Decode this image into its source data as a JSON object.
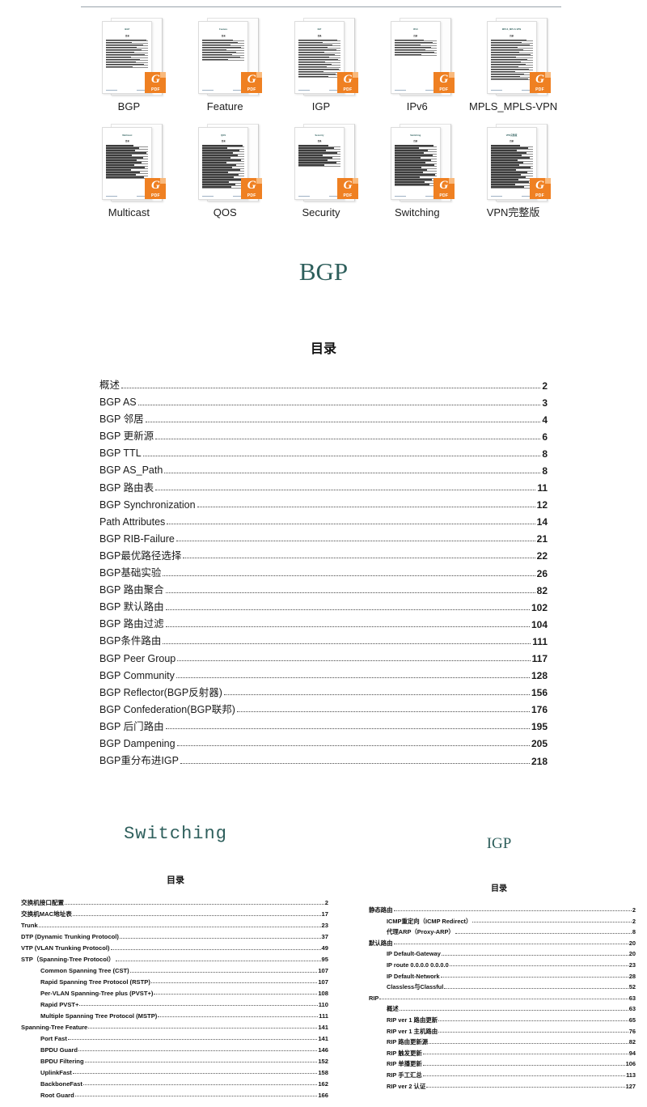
{
  "thumbnails": {
    "badge": {
      "glyph": "G",
      "label": "PDF",
      "color": "#ef8022"
    },
    "items": [
      {
        "label": "BGP",
        "mini_title": "BGP",
        "mini_sub": "目录",
        "lines": 12
      },
      {
        "label": "Feature",
        "mini_title": "Feature",
        "mini_sub": "目录",
        "lines": 9
      },
      {
        "label": "IGP",
        "mini_title": "IGP",
        "mini_sub": "目录",
        "lines": 16
      },
      {
        "label": "IPv6",
        "mini_title": "IPv6",
        "mini_sub": "目录",
        "lines": 7
      },
      {
        "label": "MPLS_MPLS-VPN",
        "mini_title": "MPLS_MPLS-VPN",
        "mini_sub": "目录",
        "lines": 17
      },
      {
        "label": "Multicast",
        "mini_title": "Multicast",
        "mini_sub": "目录",
        "lines": 14
      },
      {
        "label": "QOS",
        "mini_title": "QOS",
        "mini_sub": "目录",
        "lines": 18
      },
      {
        "label": "Security",
        "mini_title": "Security",
        "mini_sub": "目录",
        "lines": 9
      },
      {
        "label": "Switching",
        "mini_title": "Switching",
        "mini_sub": "目录",
        "lines": 17
      },
      {
        "label": "VPN完整版",
        "mini_title": "VPN完整版",
        "mini_sub": "目录",
        "lines": 18
      }
    ]
  },
  "bgp_doc": {
    "title": "BGP",
    "toc_heading": "目录",
    "title_color": "#2e5f5c",
    "entries": [
      {
        "title": "概述",
        "page": "2"
      },
      {
        "title": "BGP AS",
        "page": "3"
      },
      {
        "title": "BGP  邻居",
        "page": "4"
      },
      {
        "title": "BGP  更新源",
        "page": "6"
      },
      {
        "title": "BGP TTL",
        "page": "8"
      },
      {
        "title": "BGP AS_Path",
        "page": "8"
      },
      {
        "title": "BGP  路由表",
        "page": "11"
      },
      {
        "title": "BGP Synchronization",
        "page": "12"
      },
      {
        "title": "Path Attributes",
        "page": "14"
      },
      {
        "title": "BGP RIB-Failure",
        "page": "21"
      },
      {
        "title": "BGP最优路径选择",
        "page": "22"
      },
      {
        "title": "BGP基础实验",
        "page": "26"
      },
      {
        "title": "BGP  路由聚合",
        "page": "82"
      },
      {
        "title": "BGP  默认路由",
        "page": "102"
      },
      {
        "title": "BGP  路由过滤",
        "page": "104"
      },
      {
        "title": "BGP条件路由",
        "page": "111"
      },
      {
        "title": "BGP Peer Group",
        "page": "117"
      },
      {
        "title": "BGP Community",
        "page": "128"
      },
      {
        "title": "BGP Reflector(BGP反射器)",
        "page": "156"
      },
      {
        "title": "BGP Confederation(BGP联邦)",
        "page": "176"
      },
      {
        "title": "BGP  后门路由",
        "page": "195"
      },
      {
        "title": "BGP Dampening",
        "page": "205"
      },
      {
        "title": "BGP重分布进IGP",
        "page": "218"
      }
    ]
  },
  "switching_doc": {
    "title": "Switching",
    "toc_heading": "目录",
    "entries": [
      {
        "title": "交换机接口配置",
        "page": "2",
        "level": 1
      },
      {
        "title": "交换机MAC地址表",
        "page": "17",
        "level": 1
      },
      {
        "title": "Trunk",
        "page": "23",
        "level": 1
      },
      {
        "title": "DTP (Dynamic Trunking Protocol)",
        "page": "37",
        "level": 1
      },
      {
        "title": "VTP (VLAN Trunking Protocol)",
        "page": "49",
        "level": 1
      },
      {
        "title": "STP（Spanning-Tree Protocol）",
        "page": "95",
        "level": 1
      },
      {
        "title": "Common Spanning Tree (CST)",
        "page": "107",
        "level": 2
      },
      {
        "title": "Rapid Spanning Tree Protocol (RSTP)",
        "page": "107",
        "level": 2
      },
      {
        "title": "Per-VLAN Spanning-Tree plus (PVST+)",
        "page": "108",
        "level": 2
      },
      {
        "title": "Rapid PVST+",
        "page": "110",
        "level": 2
      },
      {
        "title": "Multiple Spanning Tree Protocol (MSTP)",
        "page": "111",
        "level": 2
      },
      {
        "title": "Spanning-Tree Feature",
        "page": "141",
        "level": 1
      },
      {
        "title": "Port Fast",
        "page": "141",
        "level": 2
      },
      {
        "title": "BPDU Guard",
        "page": "146",
        "level": 2
      },
      {
        "title": "BPDU Filtering",
        "page": "152",
        "level": 2
      },
      {
        "title": "UplinkFast",
        "page": "158",
        "level": 2
      },
      {
        "title": "BackboneFast",
        "page": "162",
        "level": 2
      },
      {
        "title": "Root Guard",
        "page": "166",
        "level": 2
      }
    ]
  },
  "igp_doc": {
    "title": "IGP",
    "toc_heading": "目录",
    "entries": [
      {
        "title": "静态路由",
        "page": "2",
        "level": 1
      },
      {
        "title": "ICMP重定向（ICMP Redirect）",
        "page": "2",
        "level": 2
      },
      {
        "title": "代理ARP（Proxy-ARP）",
        "page": "8",
        "level": 2
      },
      {
        "title": "默认路由",
        "page": "20",
        "level": 1
      },
      {
        "title": "IP Default-Gateway",
        "page": "20",
        "level": 2
      },
      {
        "title": "IP route 0.0.0.0 0.0.0.0",
        "page": "23",
        "level": 2
      },
      {
        "title": "IP Default-Network",
        "page": "28",
        "level": 2
      },
      {
        "title": "Classless与Classful",
        "page": "52",
        "level": 2
      },
      {
        "title": "RIP",
        "page": "63",
        "level": 1
      },
      {
        "title": "概述",
        "page": "63",
        "level": 2
      },
      {
        "title": "RIP ver 1  路由更新",
        "page": "65",
        "level": 2
      },
      {
        "title": "RIP ver 1  主机路由",
        "page": "76",
        "level": 2
      },
      {
        "title": "RIP  路由更新源",
        "page": "82",
        "level": 2
      },
      {
        "title": "RIP  触发更新",
        "page": "94",
        "level": 2
      },
      {
        "title": "RIP  单播更新",
        "page": "106",
        "level": 2
      },
      {
        "title": "RIP  手工汇总",
        "page": "113",
        "level": 2
      },
      {
        "title": "RIP ver 2  认证",
        "page": "127",
        "level": 2
      }
    ]
  }
}
